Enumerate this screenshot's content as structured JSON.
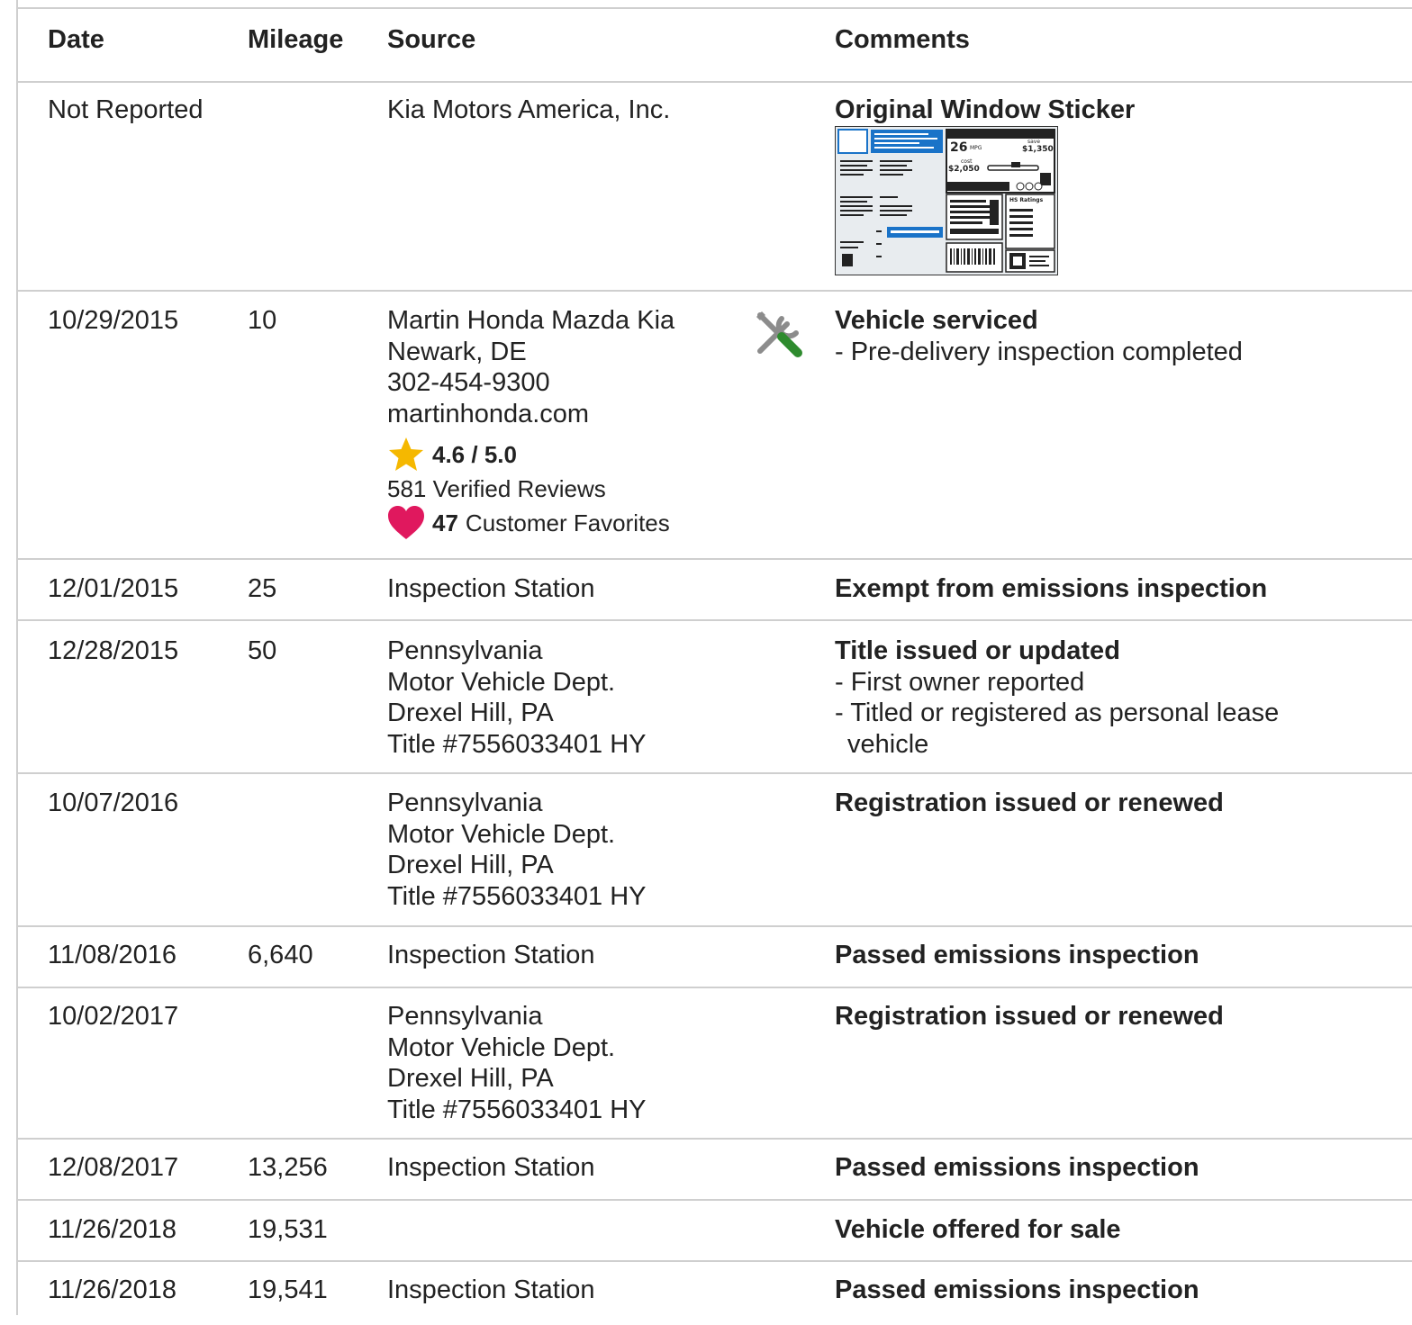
{
  "headers": {
    "date": "Date",
    "mileage": "Mileage",
    "source": "Source",
    "comments": "Comments"
  },
  "sticker": {
    "mpg": "26",
    "mpg_unit": "MPG",
    "save_label": "save",
    "save_amount": "$1,350",
    "cost_label": "cost",
    "cost_amount": "$2,050",
    "ratings_label": "HS Ratings"
  },
  "rows": [
    {
      "date": "Not Reported",
      "mileage": "",
      "source_lines": [
        "Kia Motors America, Inc."
      ],
      "comment_title": "Original Window Sticker",
      "comment_items": []
    },
    {
      "date": "10/29/2015",
      "mileage": "10",
      "source_lines": [
        "Martin Honda Mazda Kia",
        "Newark, DE",
        "302-454-9300",
        "martinhonda.com"
      ],
      "rating": "4.6 / 5.0",
      "reviews": "581 Verified Reviews",
      "favorites_count": "47",
      "favorites_label": "Customer Favorites",
      "icon": "service-tools-icon",
      "comment_title": "Vehicle serviced",
      "comment_items": [
        "- Pre-delivery inspection completed"
      ]
    },
    {
      "date": "12/01/2015",
      "mileage": "25",
      "source_lines": [
        "Inspection Station"
      ],
      "comment_title": "Exempt from emissions inspection",
      "comment_items": []
    },
    {
      "date": "12/28/2015",
      "mileage": "50",
      "source_lines": [
        "Pennsylvania",
        "Motor Vehicle Dept.",
        "Drexel Hill, PA",
        "Title #7556033401 HY"
      ],
      "comment_title": "Title issued or updated",
      "comment_items": [
        "- First owner reported",
        "- Titled or registered as personal lease vehicle"
      ]
    },
    {
      "date": "10/07/2016",
      "mileage": "",
      "source_lines": [
        "Pennsylvania",
        "Motor Vehicle Dept.",
        "Drexel Hill, PA",
        "Title #7556033401 HY"
      ],
      "comment_title": "Registration issued or renewed",
      "comment_items": []
    },
    {
      "date": "11/08/2016",
      "mileage": "6,640",
      "source_lines": [
        "Inspection Station"
      ],
      "comment_title": "Passed emissions inspection",
      "comment_items": []
    },
    {
      "date": "10/02/2017",
      "mileage": "",
      "source_lines": [
        "Pennsylvania",
        "Motor Vehicle Dept.",
        "Drexel Hill, PA",
        "Title #7556033401 HY"
      ],
      "comment_title": "Registration issued or renewed",
      "comment_items": []
    },
    {
      "date": "12/08/2017",
      "mileage": "13,256",
      "source_lines": [
        "Inspection Station"
      ],
      "comment_title": "Passed emissions inspection",
      "comment_items": []
    },
    {
      "date": "11/26/2018",
      "mileage": "19,531",
      "source_lines": [],
      "comment_title": "Vehicle offered for sale",
      "comment_items": []
    },
    {
      "date": "11/26/2018",
      "mileage": "19,541",
      "source_lines": [
        "Inspection Station"
      ],
      "comment_title": "Passed emissions inspection",
      "comment_items": []
    }
  ],
  "colors": {
    "star": "#f5b800",
    "heart": "#e0185e",
    "tool_gray": "#8c8c8c",
    "tool_green": "#2e8b2e",
    "border": "#cfcfcf",
    "sticker_blue": "#1a73c8"
  }
}
